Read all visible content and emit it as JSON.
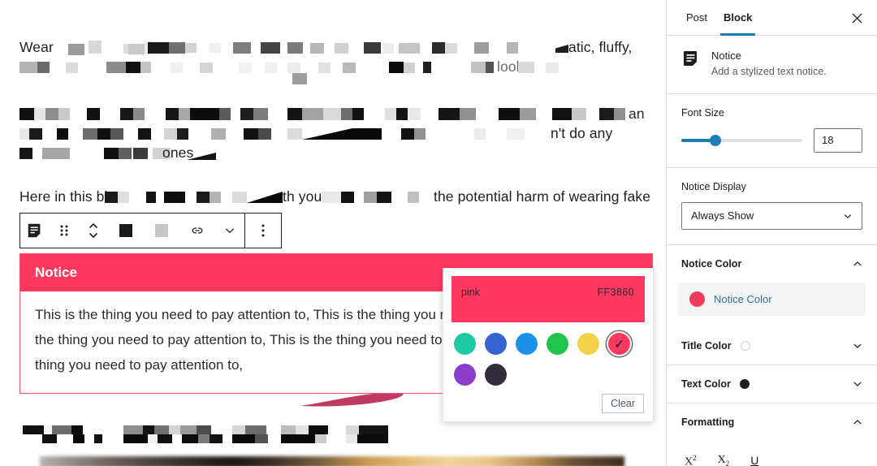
{
  "editor": {
    "paragraphs": [
      {
        "visible_prefix": "Wear",
        "visible_suffix": "atic, fluffy,",
        "trailing_fragment": "lool"
      },
      {
        "visible_suffix": "",
        "trailing_fragment": "ones"
      },
      {
        "visible_prefix": "Here in this blo",
        "mid_fragment": "th you",
        "visible_suffix": "the potential harm of wearing fake"
      }
    ],
    "line2_right_fragment": "an",
    "line3_right_fragment": "n't do any"
  },
  "toolbar": {
    "block_type_icon": "notice-block-icon",
    "drag_handle_icon": "drag-handle-icon",
    "move_updown_icon": "move-up-down-icon",
    "link_icon": "link-icon",
    "chevron_icon": "chevron-down-icon",
    "more_icon": "more-options-icon"
  },
  "notice": {
    "title": "Notice",
    "body": "This is the thing you need to pay attention to, This is the thing you need to pay attention to, This is the thing you need to pay attention to, This is the thing you need to pay attention to, This is the thing you need to pay attention to,",
    "background_color": "#FF3860",
    "title_color": "#FFFFFF",
    "text_color": "#2B2B2B"
  },
  "color_popover": {
    "selected_name": "pink",
    "selected_hex": "FF3860",
    "swatches": [
      {
        "name": "turquoise",
        "hex": "#1ECBA0",
        "selected": false
      },
      {
        "name": "indigo",
        "hex": "#3563D1",
        "selected": false
      },
      {
        "name": "blue",
        "hex": "#1C93E8",
        "selected": false
      },
      {
        "name": "green",
        "hex": "#21C44A",
        "selected": false
      },
      {
        "name": "yellow",
        "hex": "#F2D249",
        "selected": false
      },
      {
        "name": "pink",
        "hex": "#FF3860",
        "selected": true
      },
      {
        "name": "purple",
        "hex": "#8B3ECB",
        "selected": false
      },
      {
        "name": "dark",
        "hex": "#332C3B",
        "selected": false
      }
    ],
    "clear_label": "Clear",
    "check_glyph": "✓"
  },
  "sidebar": {
    "tabs": [
      {
        "label": "Post",
        "active": false
      },
      {
        "label": "Block",
        "active": true
      }
    ],
    "close_icon": "close-icon",
    "block_card": {
      "icon": "notice-block-icon",
      "title": "Notice",
      "description": "Add a stylized text notice."
    },
    "font_size": {
      "label": "Font Size",
      "value": "18",
      "percent": 28,
      "track_color": "#1D7CB8"
    },
    "notice_display": {
      "label": "Notice Display",
      "value": "Always Show",
      "chevron_icon": "chevron-down-icon"
    },
    "panels": [
      {
        "name": "notice-color",
        "title": "Notice Color",
        "expanded": true,
        "chevron_icon": "chevron-up-icon",
        "swatch_label": "Notice Color",
        "swatch_color": "#F23A5C"
      },
      {
        "name": "title-color",
        "title": "Title Color",
        "expanded": false,
        "chevron_icon": "chevron-down-icon",
        "dot_color": "#FFFFFF"
      },
      {
        "name": "text-color",
        "title": "Text Color",
        "expanded": false,
        "chevron_icon": "chevron-down-icon",
        "dot_color": "#1E1E1E"
      },
      {
        "name": "formatting",
        "title": "Formatting",
        "expanded": true,
        "chevron_icon": "chevron-up-icon"
      }
    ],
    "formatting": {
      "superscript": "X",
      "superscript_exp": "2",
      "subscript": "X",
      "subscript_exp": "2",
      "underline": "U"
    }
  }
}
